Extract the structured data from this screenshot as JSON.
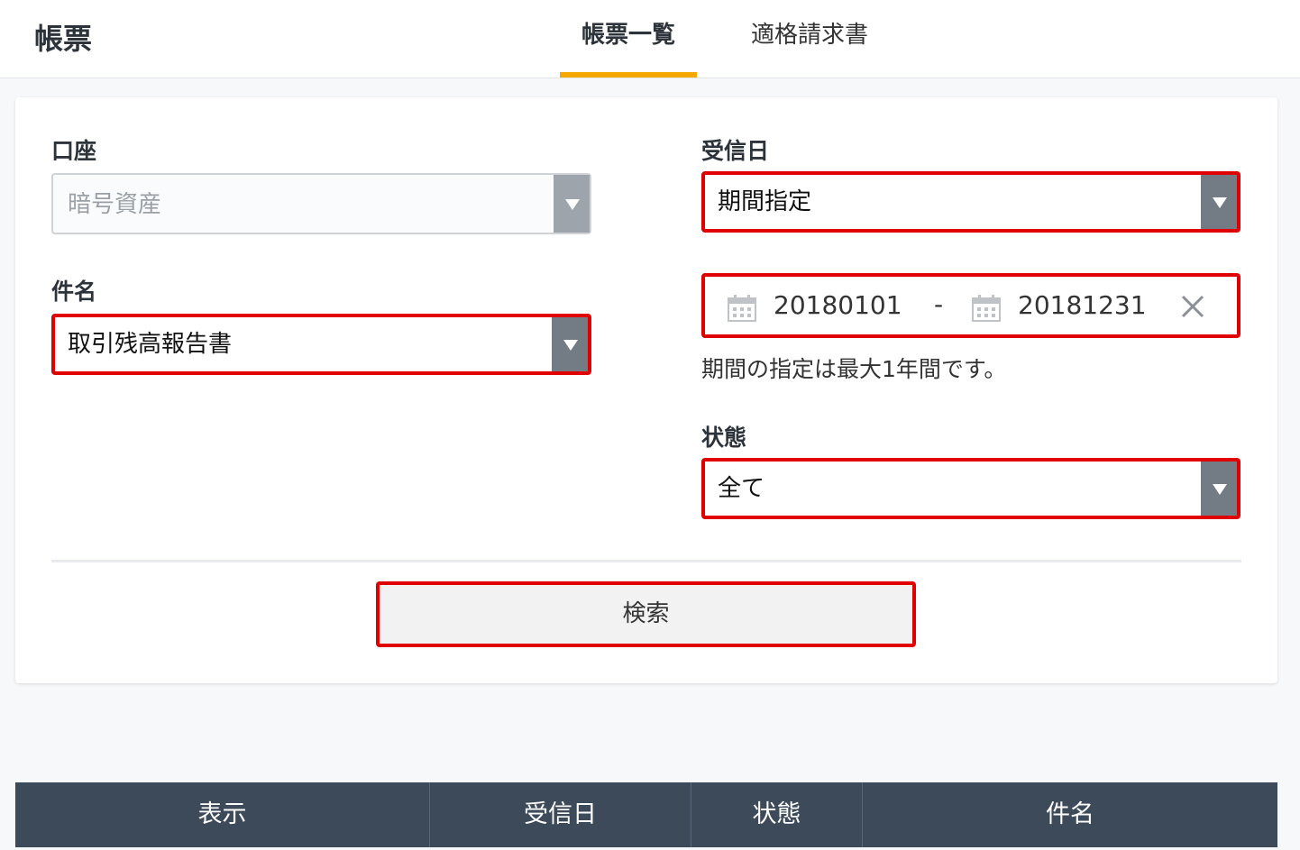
{
  "header": {
    "title": "帳票",
    "tabs": [
      {
        "label": "帳票一覧",
        "active": true
      },
      {
        "label": "適格請求書",
        "active": false
      }
    ],
    "accent_color": "#f5a800"
  },
  "filters": {
    "account": {
      "label": "口座",
      "value": "暗号資産",
      "disabled": true
    },
    "subject": {
      "label": "件名",
      "value": "取引残高報告書"
    },
    "received_date": {
      "label": "受信日",
      "value": "期間指定"
    },
    "date_range": {
      "from": "20180101",
      "separator": "-",
      "to": "20181231"
    },
    "hint": "期間の指定は最大1年間です。",
    "status": {
      "label": "状態",
      "value": "全て"
    },
    "search_button": "検索"
  },
  "table": {
    "columns": [
      "表示",
      "受信日",
      "状態",
      "件名"
    ]
  }
}
